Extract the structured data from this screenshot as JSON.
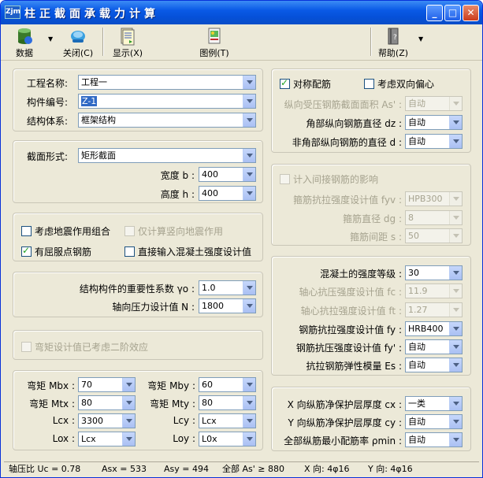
{
  "window": {
    "app_icon": "Zjm",
    "title": "柱正截面承载力计算",
    "min_label": "_",
    "max_label": "□",
    "close_label": "✕"
  },
  "toolbar": {
    "data": "数据",
    "close": "关闭(C)",
    "display": "显示(X)",
    "legend": "图例(T)",
    "help": "帮助(Z)"
  },
  "basic": {
    "project_label": "工程名称:",
    "project_value": "工程一",
    "member_label": "构件编号:",
    "member_value": "Z-1",
    "system_label": "结构体系:",
    "system_value": "框架结构"
  },
  "section": {
    "shape_label": "截面形式:",
    "shape_value": "矩形截面",
    "width_label": "宽度 b :",
    "width_value": "400",
    "height_label": "高度 h :",
    "height_value": "400"
  },
  "seismic": {
    "combo_label": "考虑地震作用组合",
    "combo_checked": false,
    "vertical_label": "仅计算竖向地震作用",
    "yield_label": "有屈服点钢筋",
    "yield_checked": true,
    "direct_label": "直接输入混凝土强度设计值",
    "direct_checked": false
  },
  "importance": {
    "gamma_label": "结构构件的重要性系数 γo :",
    "gamma_value": "1.0",
    "axial_label": "轴向压力设计值 N :",
    "axial_value": "1800"
  },
  "second_order": {
    "label": "弯矩设计值已考虑二阶效应"
  },
  "moments": {
    "mbx_label": "弯矩 Mbx :",
    "mbx_value": "70",
    "mby_label": "弯矩 Mby :",
    "mby_value": "60",
    "mtx_label": "弯矩 Mtx :",
    "mtx_value": "80",
    "mty_label": "弯矩 Mty :",
    "mty_value": "80",
    "lcx_label": "Lcx :",
    "lcx_value": "3300",
    "lcy_label": "Lcy :",
    "lcy_value": "Lcx",
    "lox_label": "Lox :",
    "lox_value": "Lcx",
    "loy_label": "Loy :",
    "loy_value": "L0x"
  },
  "rebar": {
    "symmetric_label": "对称配筋",
    "symmetric_checked": true,
    "biaxial_label": "考虑双向偏心",
    "biaxial_checked": false,
    "area_label": "纵向受压钢筋截面面积 As' :",
    "area_value": "自动",
    "corner_label": "角部纵向钢筋直径 dz :",
    "corner_value": "自动",
    "noncorner_label": "非角部纵向钢筋的直径 d :",
    "noncorner_value": "自动"
  },
  "indirect": {
    "label": "计入间接钢筋的影响",
    "fyv_label": "箍筋抗拉强度设计值 fyv :",
    "fyv_value": "HPB300",
    "dg_label": "箍筋直径 dg :",
    "dg_value": "8",
    "s_label": "箍筋间距 s :",
    "s_value": "50"
  },
  "material": {
    "grade_label": "混凝土的强度等级 :",
    "grade_value": "30",
    "fc_label": "轴心抗压强度设计值 fc :",
    "fc_value": "11.9",
    "ft_label": "轴心抗拉强度设计值 ft :",
    "ft_value": "1.27",
    "fy_label": "钢筋抗拉强度设计值 fy :",
    "fy_value": "HRB400",
    "fyp_label": "钢筋抗压强度设计值 fy' :",
    "fyp_value": "自动",
    "es_label": "抗拉钢筋弹性模量 Es :",
    "es_value": "自动"
  },
  "cover": {
    "cx_label": "X 向纵筋净保护层厚度 cx :",
    "cx_value": "一类",
    "cy_label": "Y 向纵筋净保护层厚度 cy :",
    "cy_value": "自动",
    "pmin_label": "全部纵筋最小配筋率 ρmin :",
    "pmin_value": "自动"
  },
  "status": {
    "uc": "轴压比 Uc = 0.78",
    "asx": "Asx = 533",
    "asy": "Asy = 494",
    "as_total": "全部 As' ≥ 880",
    "x_dir": "X 向: 4φ16",
    "y_dir": "Y 向: 4φ16"
  }
}
